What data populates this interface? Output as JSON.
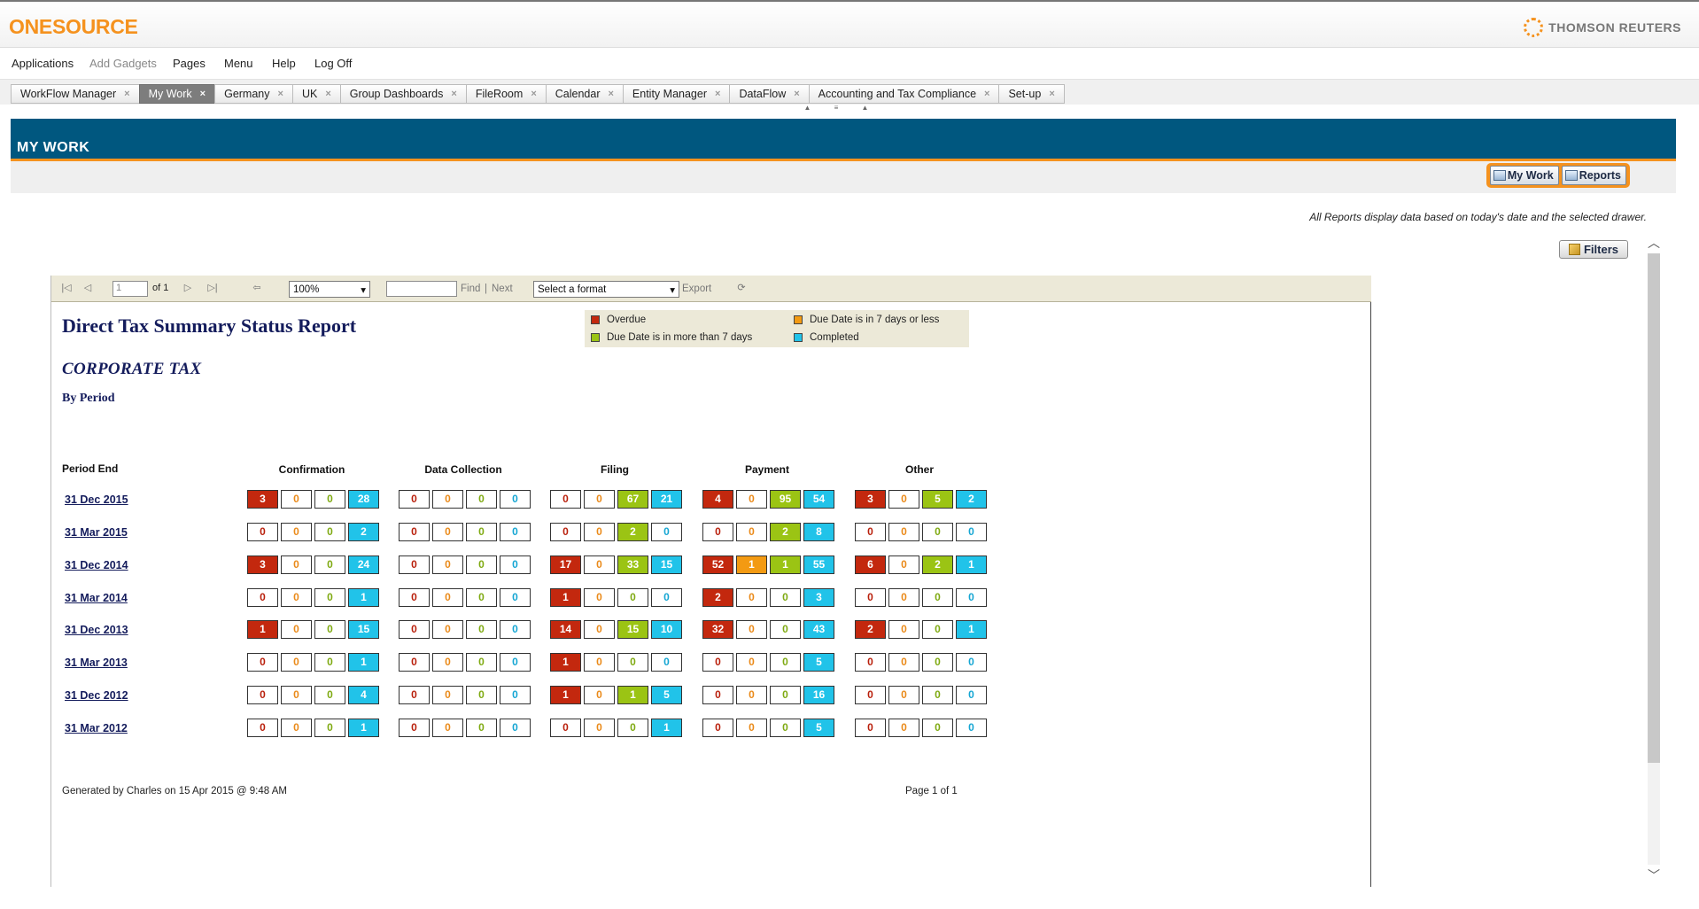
{
  "header": {
    "logo": "ONESOURCE",
    "brand": "THOMSON REUTERS"
  },
  "menu": [
    {
      "label": "Applications",
      "disabled": false
    },
    {
      "label": "Add Gadgets",
      "disabled": true
    },
    {
      "label": "Pages",
      "disabled": false
    },
    {
      "label": "Menu",
      "disabled": false
    },
    {
      "label": "Help",
      "disabled": false
    },
    {
      "label": "Log Off",
      "disabled": false
    }
  ],
  "tabs": [
    {
      "label": "WorkFlow Manager",
      "active": false
    },
    {
      "label": "My Work",
      "active": true
    },
    {
      "label": "Germany",
      "active": false
    },
    {
      "label": "UK",
      "active": false
    },
    {
      "label": "Group Dashboards",
      "active": false
    },
    {
      "label": "FileRoom",
      "active": false
    },
    {
      "label": "Calendar",
      "active": false
    },
    {
      "label": "Entity Manager",
      "active": false
    },
    {
      "label": "DataFlow",
      "active": false
    },
    {
      "label": "Accounting and Tax Compliance",
      "active": false
    },
    {
      "label": "Set-up",
      "active": false
    }
  ],
  "tab_close_glyph": "×",
  "page": {
    "title": "MY WORK",
    "switch_mywork": "My Work",
    "switch_reports": "Reports",
    "note": "All Reports display data based on today's date and the selected drawer.",
    "filters_label": "Filters"
  },
  "toolbar": {
    "page_value": "1",
    "of_label": "of 1",
    "zoom": "100%",
    "find_label": "Find",
    "separator": "|",
    "next_label": "Next",
    "format_placeholder": "Select a format",
    "export_label": "Export"
  },
  "report": {
    "title": "Direct Tax Summary Status Report",
    "subtitle": "CORPORATE TAX",
    "by": "By Period",
    "period_header": "Period End",
    "groups": [
      "Confirmation",
      "Data Collection",
      "Filing",
      "Payment",
      "Other"
    ],
    "legend": [
      {
        "label": "Overdue",
        "color": "#c3280e"
      },
      {
        "label": "Due Date is in 7 days or less",
        "color": "#f39a12"
      },
      {
        "label": "Due Date is in more than 7 days",
        "color": "#9bc414"
      },
      {
        "label": "Completed",
        "color": "#21c3e9"
      }
    ],
    "rows": [
      {
        "period": "31 Dec 2015",
        "values": [
          [
            3,
            0,
            0,
            28
          ],
          [
            0,
            0,
            0,
            0
          ],
          [
            0,
            0,
            67,
            21
          ],
          [
            4,
            0,
            95,
            54
          ],
          [
            3,
            0,
            5,
            2
          ]
        ]
      },
      {
        "period": "31 Mar 2015",
        "values": [
          [
            0,
            0,
            0,
            2
          ],
          [
            0,
            0,
            0,
            0
          ],
          [
            0,
            0,
            2,
            0
          ],
          [
            0,
            0,
            2,
            8
          ],
          [
            0,
            0,
            0,
            0
          ]
        ]
      },
      {
        "period": "31 Dec 2014",
        "values": [
          [
            3,
            0,
            0,
            24
          ],
          [
            0,
            0,
            0,
            0
          ],
          [
            17,
            0,
            33,
            15
          ],
          [
            52,
            1,
            1,
            55
          ],
          [
            6,
            0,
            2,
            1
          ]
        ]
      },
      {
        "period": "31 Mar 2014",
        "values": [
          [
            0,
            0,
            0,
            1
          ],
          [
            0,
            0,
            0,
            0
          ],
          [
            1,
            0,
            0,
            0
          ],
          [
            2,
            0,
            0,
            3
          ],
          [
            0,
            0,
            0,
            0
          ]
        ]
      },
      {
        "period": "31 Dec 2013",
        "values": [
          [
            1,
            0,
            0,
            15
          ],
          [
            0,
            0,
            0,
            0
          ],
          [
            14,
            0,
            15,
            10
          ],
          [
            32,
            0,
            0,
            43
          ],
          [
            2,
            0,
            0,
            1
          ]
        ]
      },
      {
        "period": "31 Mar 2013",
        "values": [
          [
            0,
            0,
            0,
            1
          ],
          [
            0,
            0,
            0,
            0
          ],
          [
            1,
            0,
            0,
            0
          ],
          [
            0,
            0,
            0,
            5
          ],
          [
            0,
            0,
            0,
            0
          ]
        ]
      },
      {
        "period": "31 Dec 2012",
        "values": [
          [
            0,
            0,
            0,
            4
          ],
          [
            0,
            0,
            0,
            0
          ],
          [
            1,
            0,
            1,
            5
          ],
          [
            0,
            0,
            0,
            16
          ],
          [
            0,
            0,
            0,
            0
          ]
        ]
      },
      {
        "period": "31 Mar 2012",
        "values": [
          [
            0,
            0,
            0,
            1
          ],
          [
            0,
            0,
            0,
            0
          ],
          [
            0,
            0,
            0,
            1
          ],
          [
            0,
            0,
            0,
            5
          ],
          [
            0,
            0,
            0,
            0
          ]
        ]
      }
    ],
    "generated": "Generated by Charles on 15 Apr 2015 @ 9:48 AM",
    "page_footer": "Page 1 of 1"
  }
}
